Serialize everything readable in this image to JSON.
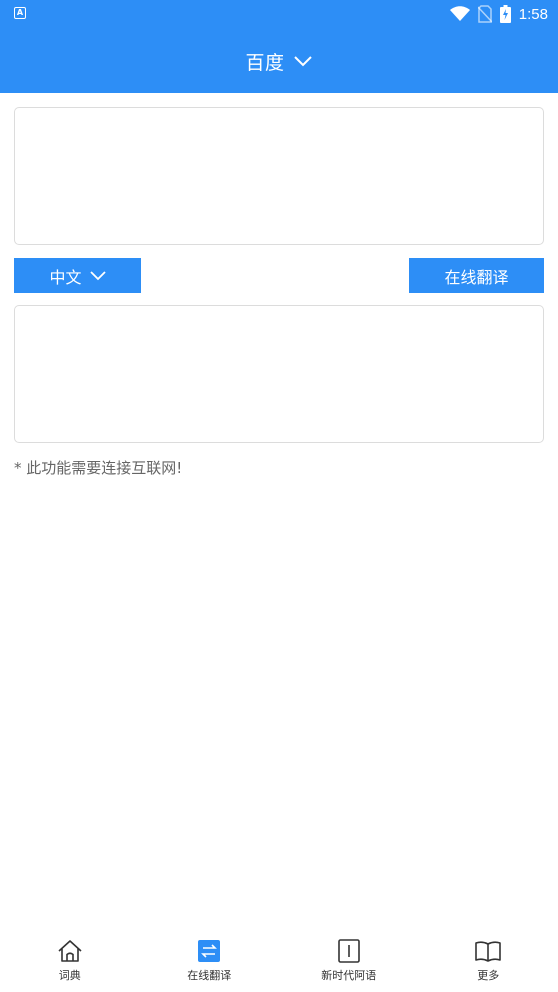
{
  "status_bar": {
    "left_icon_label": "A",
    "time": "1:58"
  },
  "header": {
    "title": "百度"
  },
  "translator": {
    "source_language": "中文",
    "translate_button": "在线翻译",
    "note": "* 此功能需要连接互联网!"
  },
  "bottom_nav": {
    "items": [
      {
        "label": "词典",
        "icon": "home-icon"
      },
      {
        "label": "在线翻译",
        "icon": "translate-icon",
        "active": true
      },
      {
        "label": "新时代阿语",
        "icon": "info-icon"
      },
      {
        "label": "更多",
        "icon": "book-icon"
      }
    ]
  },
  "colors": {
    "primary": "#2d8ef6",
    "border": "#dcdcdc",
    "note": "#666666"
  }
}
